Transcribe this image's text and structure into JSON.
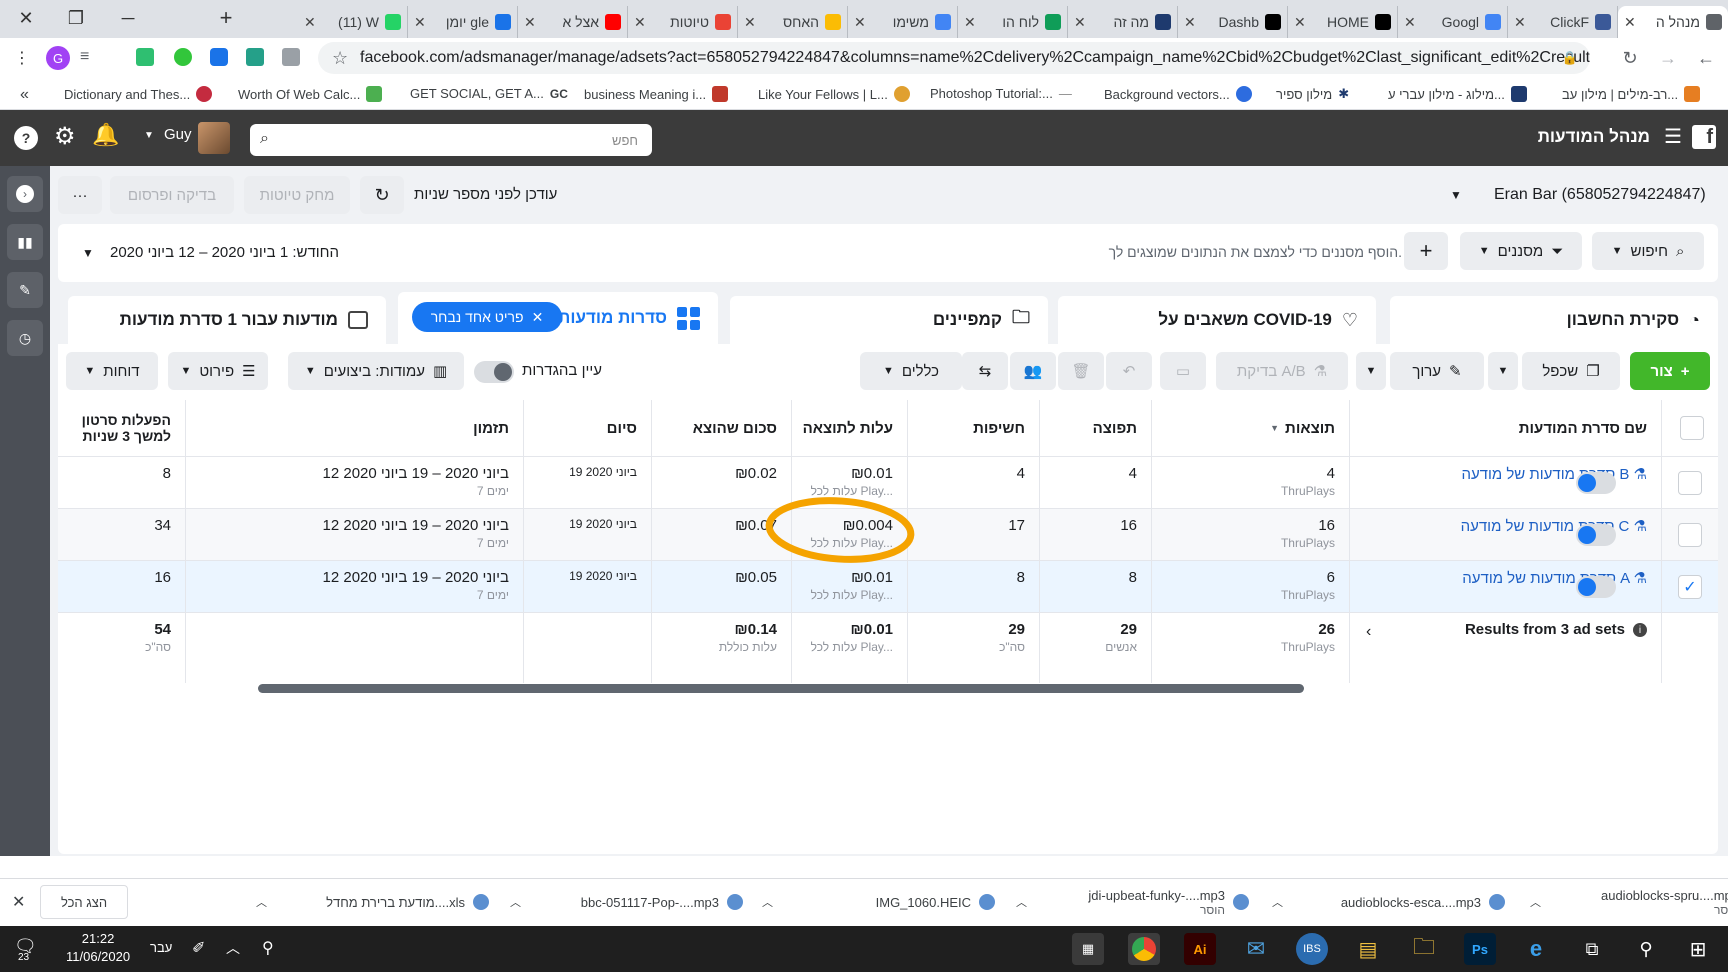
{
  "browser": {
    "tabs": [
      {
        "title": "מנהל ה",
        "fav": "#5f6368",
        "active": true
      },
      {
        "title": "ClickF",
        "fav": "#3b5998"
      },
      {
        "title": "Googl",
        "fav": "#4285f4"
      },
      {
        "title": "HOME",
        "fav": "#000000"
      },
      {
        "title": "Dashb",
        "fav": "#000000"
      },
      {
        "title": "מה זה",
        "fav": "#1e3a6e"
      },
      {
        "title": "לוח הו",
        "fav": "#0f9d58"
      },
      {
        "title": "משימו",
        "fav": "#4285f4"
      },
      {
        "title": "האחס",
        "fav": "#fbbc04"
      },
      {
        "title": "טיוטות",
        "fav": "#ea4335"
      },
      {
        "title": "אצל א",
        "fav": "#ff0000"
      },
      {
        "title": "יומן gle",
        "fav": "#1a73e8"
      },
      {
        "title": "(11) W",
        "fav": "#25d366"
      }
    ],
    "url": "facebook.com/adsmanager/manage/adsets?act=658052794224847&columns=name%2Cdelivery%2Ccampaign_name%2Cbid%2Cbudget%2Clast_significant_edit%2Cresults...",
    "bookmarks": [
      "Dictionary and Thes...",
      "Worth Of Web Calc...",
      "GET SOCIAL, GET A...",
      "business Meaning i...",
      "Like Your Fellows | L...",
      "Photoshop Tutorial:...",
      "Background vectors...",
      "מילון ספיר",
      "מילוג - מילון עברי ע...",
      "רב-מילים | מילון עב..."
    ],
    "bookmarks_overflow": "«"
  },
  "fb_header": {
    "title": "מנהל המודעות",
    "user": "Guy",
    "search_placeholder": "חפש"
  },
  "toolbar": {
    "account": "Eran Bar (658052794224847)",
    "updated": "עודכן לפני מספר שניות",
    "discard": "מחק טיוטות",
    "review": "בדיקה ופרסום",
    "more": "···"
  },
  "filterbar": {
    "search": "חיפוש",
    "filters": "מסננים",
    "add": "+",
    "hint": "הוסף מסננים כדי לצמצם את הנתונים שמוצגים לך.",
    "date": "החודש: 1 ביוני 2020 – 12 ביוני 2020"
  },
  "nav_tabs": {
    "overview": "סקירת החשבון",
    "covid": "משאבים על COVID-19",
    "campaigns": "קמפיינים",
    "adsets": "סדרות מודעות",
    "selected_pill": "פריט אחד נבחר",
    "ads": "מודעות עבור 1 סדרת מודעות"
  },
  "actions": {
    "create": "צור",
    "duplicate": "שכפל",
    "edit": "ערוך",
    "abtest": "בדיקת A/B",
    "rules": "כללים",
    "view_setup": "עיין בהגדרות",
    "columns": "עמודות: ביצועים",
    "breakdown": "פירוט",
    "reports": "דוחות"
  },
  "table": {
    "headers": {
      "name": "שם סדרת המודעות",
      "results": "תוצאות",
      "reach": "תפוצה",
      "impressions": "חשיפות",
      "cpr": "עלות לתוצאה",
      "spent": "סכום שהוצא",
      "end": "סיום",
      "schedule": "תזמון",
      "video_line1": "הפעלות סרטון",
      "video_line2": "למשך 3 שניות"
    },
    "rows": [
      {
        "name": "סדרת מודעות של מודעה B",
        "results": "4",
        "results_sub": "ThruPlays",
        "reach": "4",
        "impressions": "4",
        "cpr": "₪0.01",
        "cpr_sub": "עלות לכל Play...",
        "spent": "₪0.02",
        "end": "19 ביוני 2020",
        "schedule": "12 ביוני 2020 – 19 ביוני 2020",
        "schedule_sub": "7 ימים",
        "video": "8",
        "checked": false
      },
      {
        "name": "סדרת מודעות של מודעה C",
        "results": "16",
        "results_sub": "ThruPlays",
        "reach": "16",
        "impressions": "17",
        "cpr": "₪0.004",
        "cpr_sub": "עלות לכל Play...",
        "spent": "₪0.07",
        "end": "19 ביוני 2020",
        "schedule": "12 ביוני 2020 – 19 ביוני 2020",
        "schedule_sub": "7 ימים",
        "video": "34",
        "checked": false
      },
      {
        "name": "סדרת מודעות של מודעה A",
        "results": "6",
        "results_sub": "ThruPlays",
        "reach": "8",
        "impressions": "8",
        "cpr": "₪0.01",
        "cpr_sub": "עלות לכל Play...",
        "spent": "₪0.05",
        "end": "19 ביוני 2020",
        "schedule": "12 ביוני 2020 – 19 ביוני 2020",
        "schedule_sub": "7 ימים",
        "video": "16",
        "checked": true
      }
    ],
    "summary": {
      "label": "Results from 3 ad sets",
      "results": "26",
      "results_sub": "ThruPlays",
      "reach": "29",
      "reach_sub": "אנשים",
      "impressions": "29",
      "impressions_sub": "סה\"כ",
      "cpr": "₪0.01",
      "cpr_sub": "עלות לכל Play...",
      "spent": "₪0.14",
      "spent_sub": "עלות כוללת",
      "video": "54",
      "video_sub": "סה\"כ"
    }
  },
  "downloads": {
    "show_all": "הצג הכל",
    "items": [
      {
        "name": "audioblocks-spru....mp3",
        "sub": "הוסר"
      },
      {
        "name": "audioblocks-esca....mp3",
        "sub": ""
      },
      {
        "name": "jdi-upbeat-funky-....mp3",
        "sub": "הוסר"
      },
      {
        "name": "IMG_1060.HEIC",
        "sub": ""
      },
      {
        "name": "bbc-051117-Pop-....mp3",
        "sub": ""
      },
      {
        "name": "מודעת ברירת מחדל....xls",
        "sub": ""
      }
    ]
  },
  "taskbar": {
    "time": "21:22",
    "date": "11/06/2020",
    "lang": "עבר",
    "notif": "23"
  },
  "colors": {
    "fb_blue": "#1877f2",
    "create_green": "#42b72a",
    "highlight": "#f5a300"
  }
}
